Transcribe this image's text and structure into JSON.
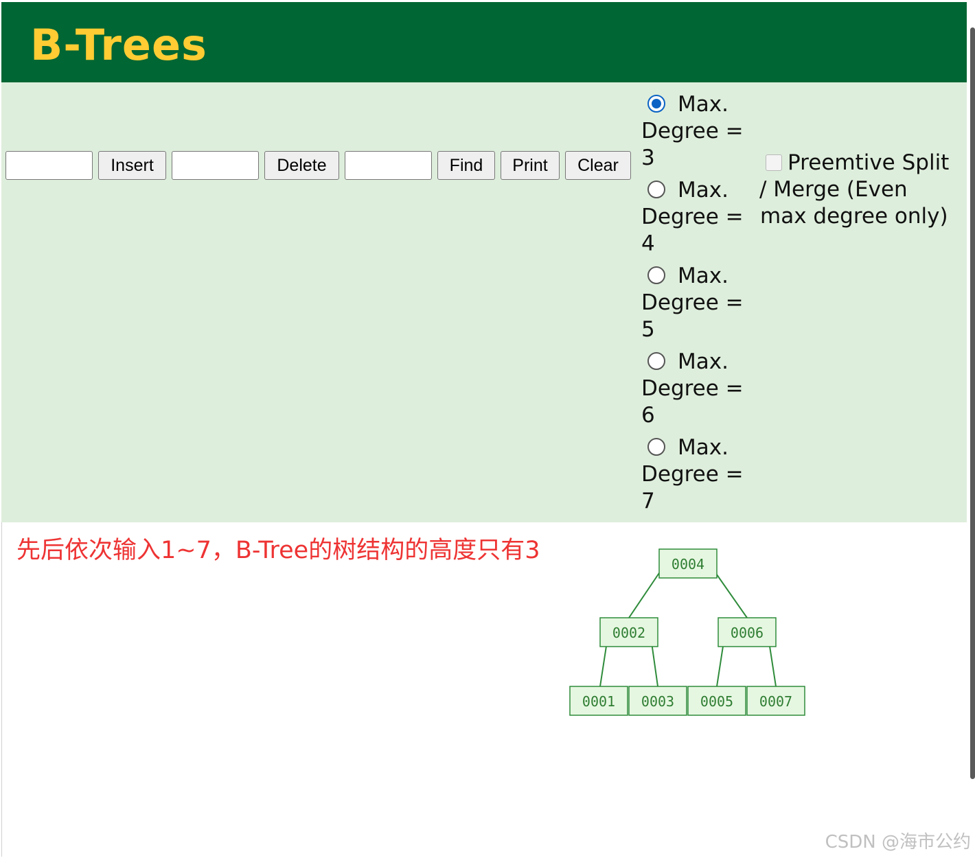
{
  "header": {
    "title": "B-Trees"
  },
  "controls": {
    "insert_input_value": "",
    "insert_button": "Insert",
    "delete_input_value": "",
    "delete_button": "Delete",
    "find_input_value": "",
    "find_button": "Find",
    "print_button": "Print",
    "clear_button": "Clear",
    "degree_options": [
      {
        "line1": "Max.",
        "line2": "Degree =",
        "line3": "3",
        "selected": true
      },
      {
        "line1": "Max.",
        "line2": "Degree =",
        "line3": "4",
        "selected": false
      },
      {
        "line1": "Max.",
        "line2": "Degree =",
        "line3": "5",
        "selected": false
      },
      {
        "line1": "Max.",
        "line2": "Degree =",
        "line3": "6",
        "selected": false
      },
      {
        "line1": "Max.",
        "line2": "Degree =",
        "line3": "7",
        "selected": false
      }
    ],
    "preemptive": {
      "line1": "Preemtive Split",
      "line2": "/ Merge (Even",
      "line3": "max degree only)",
      "checked": false
    }
  },
  "caption": "先后依次输入1~7，B-Tree的树结构的高度只有3",
  "tree": {
    "root": "0004",
    "level2": [
      "0002",
      "0006"
    ],
    "leaves": [
      "0001",
      "0003",
      "0005",
      "0007"
    ],
    "node_color": "#e6f7e1",
    "edge_color": "#2e8b3a"
  },
  "watermark": "CSDN @海市公约"
}
